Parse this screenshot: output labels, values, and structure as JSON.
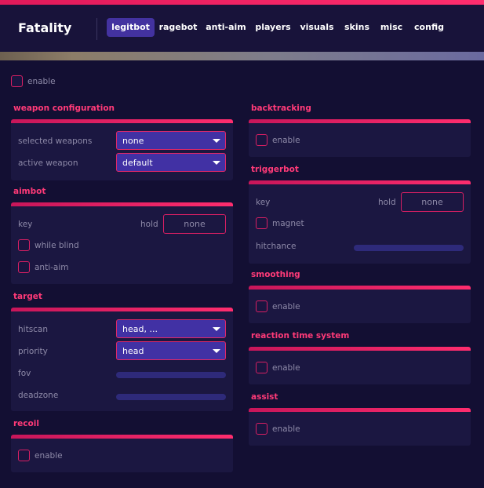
{
  "app": {
    "title": "Fatality"
  },
  "tabs": [
    "legitbot",
    "ragebot",
    "anti-aim",
    "players",
    "visuals",
    "skins",
    "misc",
    "config"
  ],
  "active_tab": "legitbot",
  "colors": {
    "accent": "#ff2d6e",
    "background": "#130f33",
    "panel": "#1b1741",
    "dropdown": "#4131a4"
  },
  "main_enable": {
    "label": "enable"
  },
  "weapon_configuration": {
    "title": "weapon configuration",
    "selected_weapons_label": "selected weapons",
    "selected_weapons_value": "none",
    "active_weapon_label": "active weapon",
    "active_weapon_value": "default"
  },
  "aimbot": {
    "title": "aimbot",
    "key_label": "key",
    "key_mode": "hold",
    "key_value": "none",
    "while_blind_label": "while blind",
    "anti_aim_label": "anti-aim"
  },
  "target": {
    "title": "target",
    "hitscan_label": "hitscan",
    "hitscan_value": "head, ...",
    "priority_label": "priority",
    "priority_value": "head",
    "fov_label": "fov",
    "deadzone_label": "deadzone"
  },
  "recoil": {
    "title": "recoil",
    "enable_label": "enable"
  },
  "backtracking": {
    "title": "backtracking",
    "enable_label": "enable"
  },
  "triggerbot": {
    "title": "triggerbot",
    "key_label": "key",
    "key_mode": "hold",
    "key_value": "none",
    "magnet_label": "magnet",
    "hitchance_label": "hitchance"
  },
  "smoothing": {
    "title": "smoothing",
    "enable_label": "enable"
  },
  "reaction_time_system": {
    "title": "reaction time system",
    "enable_label": "enable"
  },
  "assist": {
    "title": "assist",
    "enable_label": "enable"
  }
}
